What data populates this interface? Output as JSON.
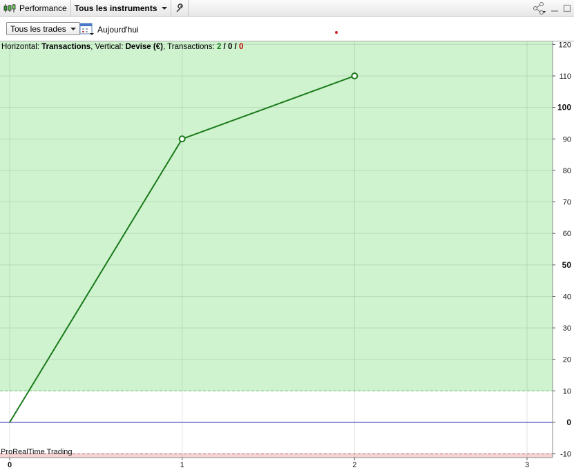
{
  "titlebar": {
    "app_label": "Performance",
    "instrument_selector": "Tous les instruments"
  },
  "toolbar": {
    "filter_dropdown": "Tous les trades",
    "date_label": "Aujourd'hui"
  },
  "info": {
    "prefix": "Horizontal: ",
    "horizontal_value": "Transactions",
    "vertical_label": ", Vertical: ",
    "vertical_value": "Devise (€)",
    "transactions_label": ", Transactions: ",
    "winning": "2",
    "neutral": "0",
    "losing": "0",
    "sep": " / "
  },
  "watermark": "ProRealTime Trading",
  "colors": {
    "profit_zone": "#cff2cf",
    "loss_zone": "#f6d4d4",
    "line": "#1a7a1a",
    "zero_line": "#2a2aa8",
    "dashed": "#6cc06c"
  },
  "chart_data": {
    "type": "line",
    "x": [
      0,
      1,
      2
    ],
    "series": [
      {
        "values": [
          0,
          90,
          110
        ]
      }
    ],
    "x_ticks": [
      "0",
      "1",
      "2",
      "3"
    ],
    "y_ticks": [
      "-10",
      "0",
      "10",
      "20",
      "30",
      "40",
      "50",
      "60",
      "70",
      "80",
      "90",
      "100",
      "110",
      "120"
    ],
    "bold_y_ticks": [
      "0",
      "50",
      "100"
    ],
    "xlim": [
      0,
      3
    ],
    "ylim": [
      -10,
      120
    ],
    "grid": true,
    "profit_threshold": 10,
    "loss_threshold": -10,
    "xlabel": "Transactions",
    "ylabel": "Devise (€)"
  }
}
